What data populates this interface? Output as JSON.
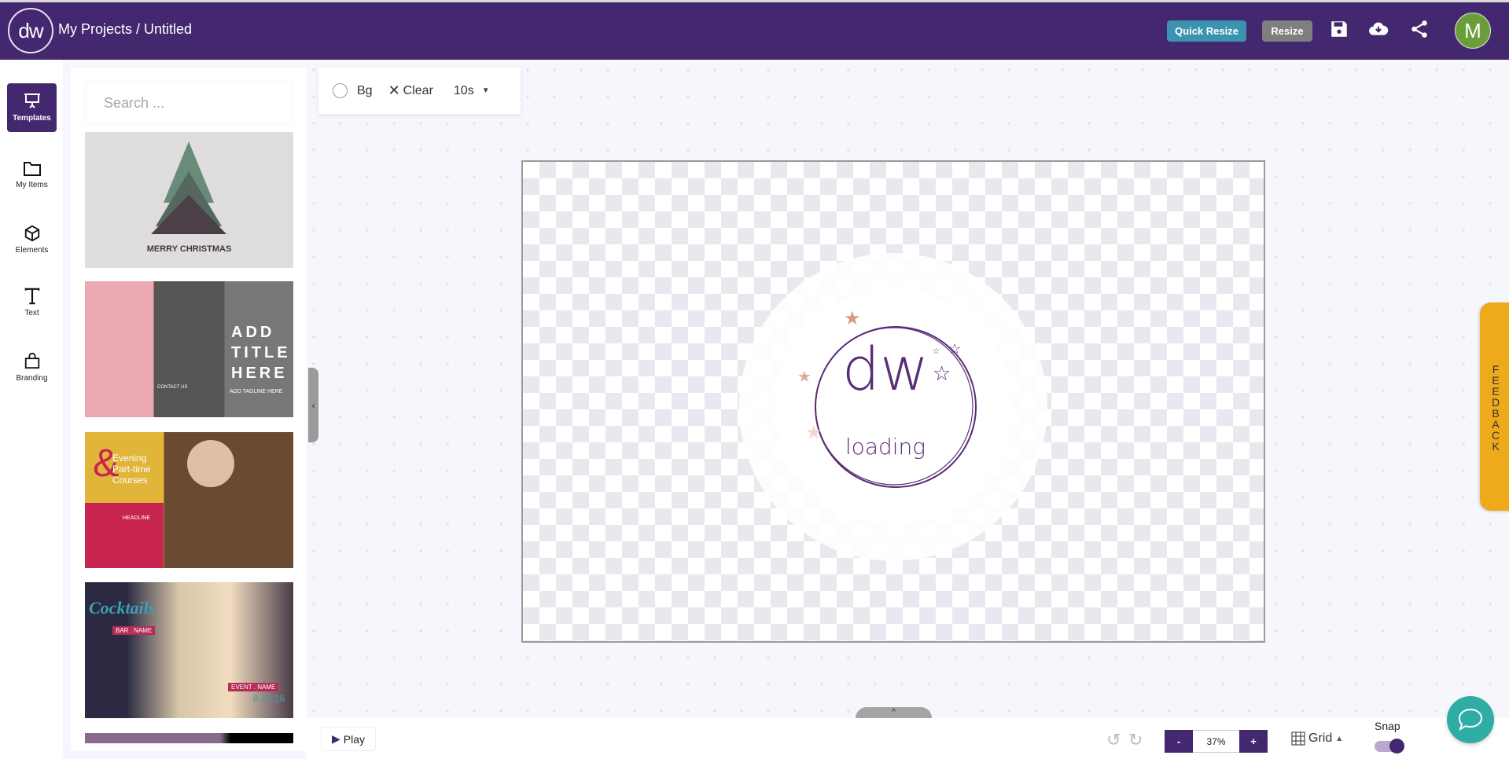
{
  "header": {
    "logo_text": "dw",
    "title": "My Projects / Untitled",
    "quick_resize": "Quick Resize",
    "resize": "Resize",
    "avatar_initial": "M",
    "icons": [
      "save-icon",
      "cloud-download-icon",
      "share-icon"
    ]
  },
  "sidebar": {
    "items": [
      {
        "label": "Templates",
        "icon": "presentation-icon",
        "active": true
      },
      {
        "label": "My Items",
        "icon": "folder-icon"
      },
      {
        "label": "Elements",
        "icon": "cube-icon"
      },
      {
        "label": "Text",
        "icon": "text-icon"
      },
      {
        "label": "Branding",
        "icon": "bag-icon"
      }
    ]
  },
  "panel": {
    "search_placeholder": "Search ...",
    "templates": [
      {
        "text": [
          "MERRY CHRISTMAS"
        ]
      },
      {
        "text": [
          "ADD",
          "TITLE",
          "HERE",
          "ADD TAGLINE HERE",
          "CONTACT US"
        ]
      },
      {
        "text": [
          "Evening",
          "Part-time",
          "Courses",
          "HEADLINE"
        ]
      },
      {
        "text": [
          "Cocktails",
          "BAR . NAME",
          "EVENT . NAME",
          "8.10.16"
        ]
      }
    ]
  },
  "toolbar": {
    "bg": "Bg",
    "clear": "Clear",
    "duration": "10s"
  },
  "canvas": {
    "loader_logo": "dw",
    "loader_text": "loading"
  },
  "feedback": "FEEDBACK",
  "bottom": {
    "play": "Play",
    "zoom_minus": "-",
    "zoom_value": "37%",
    "zoom_plus": "+",
    "grid": "Grid",
    "snap": "Snap",
    "snap_on": true
  },
  "colors": {
    "brand": "#44286f",
    "quick_resize": "#3b93b0",
    "feedback": "#eeaa1a",
    "chat": "#2fada5",
    "avatar": "#6b9e3a"
  }
}
